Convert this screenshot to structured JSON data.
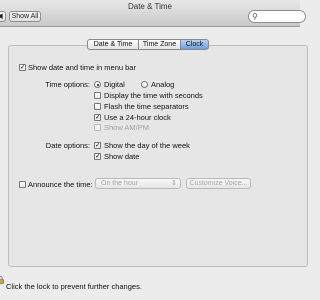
{
  "window": {
    "title": "Date & Time"
  },
  "toolbar": {
    "back_label": "◀",
    "show_all_label": "Show All",
    "search_placeholder": ""
  },
  "tabs": [
    {
      "label": "Date & Time",
      "active": false
    },
    {
      "label": "Time Zone",
      "active": false
    },
    {
      "label": "Clock",
      "active": true
    }
  ],
  "clock": {
    "show_in_menu_bar": {
      "label": "Show date and time in menu bar",
      "checked": true
    },
    "time_options": {
      "label": "Time options:",
      "digital": {
        "label": "Digital",
        "selected": true
      },
      "analog": {
        "label": "Analog",
        "selected": false
      },
      "seconds": {
        "label": "Display the time with seconds",
        "checked": false
      },
      "flash": {
        "label": "Flash the time separators",
        "checked": false
      },
      "h24": {
        "label": "Use a 24-hour clock",
        "checked": true
      },
      "ampm": {
        "label": "Show AM/PM",
        "checked": false,
        "disabled": true
      }
    },
    "date_options": {
      "label": "Date options:",
      "day_of_week": {
        "label": "Show the day of the week",
        "checked": true
      },
      "show_date": {
        "label": "Show date",
        "checked": true
      }
    },
    "announce": {
      "label": "Announce the time:",
      "checked": false,
      "interval_value": "On the hour",
      "customize_label": "Customize Voice..."
    }
  },
  "lock": {
    "text": "Click the lock to prevent further changes."
  },
  "icons": {
    "check": "✓",
    "search": "⚲",
    "updown": "⇕"
  }
}
